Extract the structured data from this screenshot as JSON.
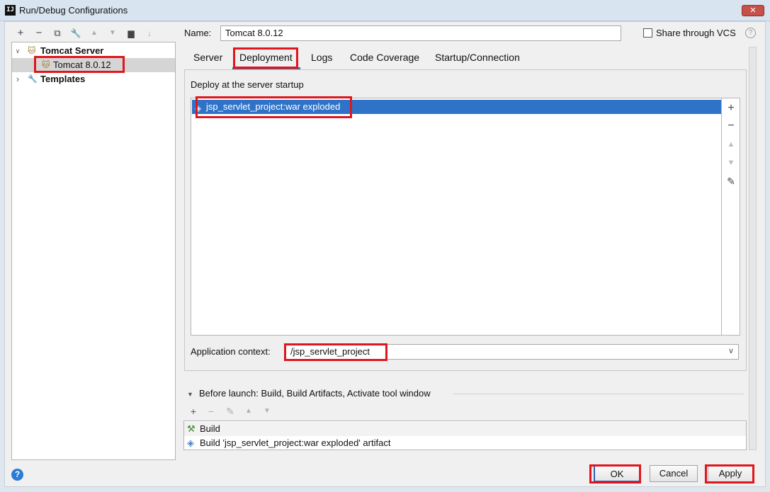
{
  "window": {
    "app_icon": "intellij-icon",
    "title": "Run/Debug Configurations",
    "close_glyph": "✕"
  },
  "left_toolbar": {
    "icons": [
      "plus-icon",
      "minus-icon",
      "copy-icon",
      "wrench-icon",
      "arrow-up-icon",
      "arrow-down-icon",
      "folder-icon",
      "sort-icon"
    ],
    "glyphs": [
      "+",
      "−",
      "⧉",
      "🔧",
      "▲",
      "▼",
      "▆",
      "↓"
    ]
  },
  "tree": {
    "items": [
      {
        "label": "Tomcat Server",
        "expanded": true,
        "icon": "tomcat-icon"
      },
      {
        "label": "Tomcat 8.0.12",
        "selected": true,
        "icon": "tomcat-icon"
      },
      {
        "label": "Templates",
        "expanded": false,
        "icon": "wrench-icon"
      }
    ],
    "expanded_glyph": "∨",
    "collapsed_glyph": "›",
    "tomcat_glyph": "🐱",
    "wrench_glyph": "🔧"
  },
  "name_field": {
    "label": "Name:",
    "value": "Tomcat 8.0.12"
  },
  "share": {
    "label": "Share through VCS",
    "checked": false,
    "help_glyph": "?"
  },
  "tabs": [
    {
      "label": "Server",
      "active": false
    },
    {
      "label": "Deployment",
      "active": true
    },
    {
      "label": "Logs",
      "active": false
    },
    {
      "label": "Code Coverage",
      "active": false
    },
    {
      "label": "Startup/Connection",
      "active": false
    }
  ],
  "deployment": {
    "section_label": "Deploy at the server startup",
    "artifacts": [
      {
        "label": "jsp_servlet_project:war exploded",
        "selected": true,
        "icon": "artifact-icon"
      }
    ],
    "side_buttons": [
      "+",
      "−",
      "▲",
      "▼",
      "✎"
    ],
    "context_label": "Application context:",
    "context_value": "/jsp_servlet_project",
    "dropdown_glyph": "∨"
  },
  "before_launch": {
    "label": "Before launch: Build, Build Artifacts, Activate tool window",
    "collapse_glyph": "▼",
    "toolbar_glyphs": [
      "+",
      "−",
      "✎",
      "▲",
      "▼"
    ],
    "tasks": [
      {
        "label": "Build",
        "icon": "hammer-icon",
        "glyph": "⚒"
      },
      {
        "label": "Build 'jsp_servlet_project:war exploded' artifact",
        "icon": "artifact-icon",
        "glyph": "◈"
      }
    ]
  },
  "footer": {
    "help_glyph": "?",
    "ok_label": "OK",
    "cancel_label": "Cancel",
    "apply_label": "Apply"
  },
  "colors": {
    "selection_blue": "#2f73c8",
    "annotation_red": "#e0161c",
    "help_blue": "#2a7ad6"
  }
}
